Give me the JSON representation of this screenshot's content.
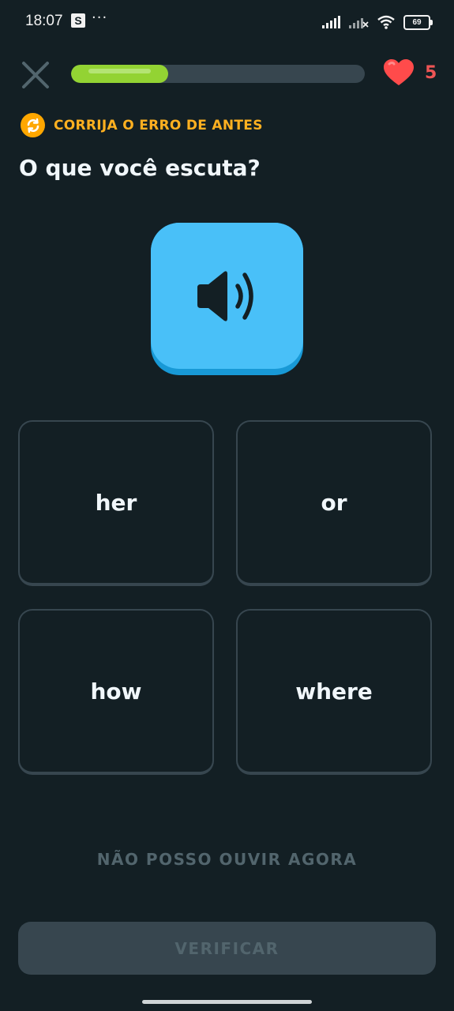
{
  "status_bar": {
    "time": "18:07",
    "app_badge": "S",
    "more": "···",
    "battery": "69",
    "icons": [
      "signal-icon",
      "signal-off-icon",
      "wifi-icon",
      "battery-icon"
    ]
  },
  "top_bar": {
    "close_icon": "close-icon",
    "progress_fraction": 0.33,
    "hearts": "5",
    "heart_color": "#ff4b4b"
  },
  "header": {
    "review_label": "CORRIJA O ERRO DE ANTES",
    "review_icon": "refresh-icon",
    "prompt": "O que você escuta?"
  },
  "speaker": {
    "icon": "speaker-icon"
  },
  "options": [
    "her",
    "or",
    "how",
    "where"
  ],
  "footer": {
    "cant_listen": "NÃO POSSO OUVIR AGORA",
    "verify": "VERIFICAR"
  },
  "colors": {
    "background": "#131f24",
    "accent_blue": "#49c0f8",
    "progress_green": "#93d333",
    "review_orange": "#ffa700",
    "disabled": "#37464f"
  }
}
